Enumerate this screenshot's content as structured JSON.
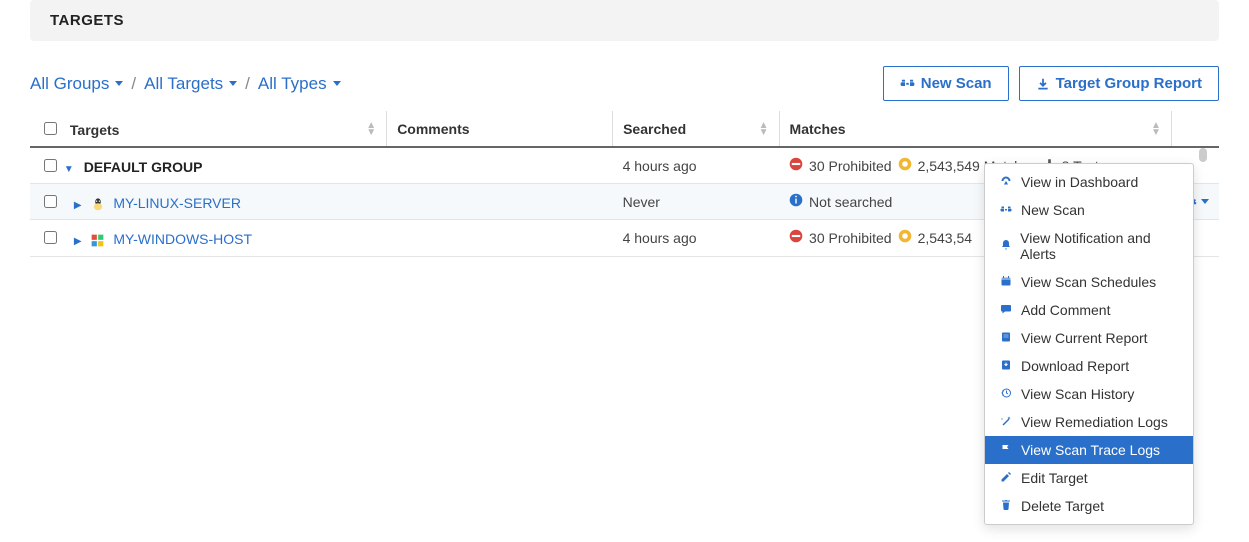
{
  "page_title": "TARGETS",
  "filters": {
    "group": "All Groups",
    "target": "All Targets",
    "type": "All Types"
  },
  "actions": {
    "new_scan": "New Scan",
    "target_group_report": "Target Group Report"
  },
  "columns": {
    "targets": "Targets",
    "comments": "Comments",
    "searched": "Searched",
    "matches": "Matches"
  },
  "group_row": {
    "name": "DEFAULT GROUP",
    "searched": "4 hours ago",
    "matches": {
      "prohibited": "30 Prohibited",
      "count": "2,543,549 Matches",
      "test": "8 Test"
    }
  },
  "rows": [
    {
      "name": "MY-LINUX-SERVER",
      "os": "linux",
      "searched": "Never",
      "not_searched_label": "Not searched",
      "matches": null,
      "has_gear": true
    },
    {
      "name": "MY-WINDOWS-HOST",
      "os": "windows",
      "searched": "4 hours ago",
      "matches": {
        "prohibited": "30 Prohibited",
        "count_partial": "2,543,54"
      },
      "has_gear": false
    }
  ],
  "dropdown": {
    "items": [
      {
        "icon": "dashboard",
        "label": "View in Dashboard"
      },
      {
        "icon": "binoculars",
        "label": "New Scan"
      },
      {
        "icon": "bell",
        "label": "View Notification and Alerts"
      },
      {
        "icon": "calendar",
        "label": "View Scan Schedules"
      },
      {
        "icon": "comment",
        "label": "Add Comment"
      },
      {
        "icon": "report",
        "label": "View Current Report"
      },
      {
        "icon": "download",
        "label": "Download Report"
      },
      {
        "icon": "history",
        "label": "View Scan History"
      },
      {
        "icon": "wand",
        "label": "View Remediation Logs"
      },
      {
        "icon": "flag",
        "label": "View Scan Trace Logs",
        "active": true
      },
      {
        "icon": "pencil",
        "label": "Edit Target"
      },
      {
        "icon": "trash",
        "label": "Delete Target"
      }
    ]
  }
}
